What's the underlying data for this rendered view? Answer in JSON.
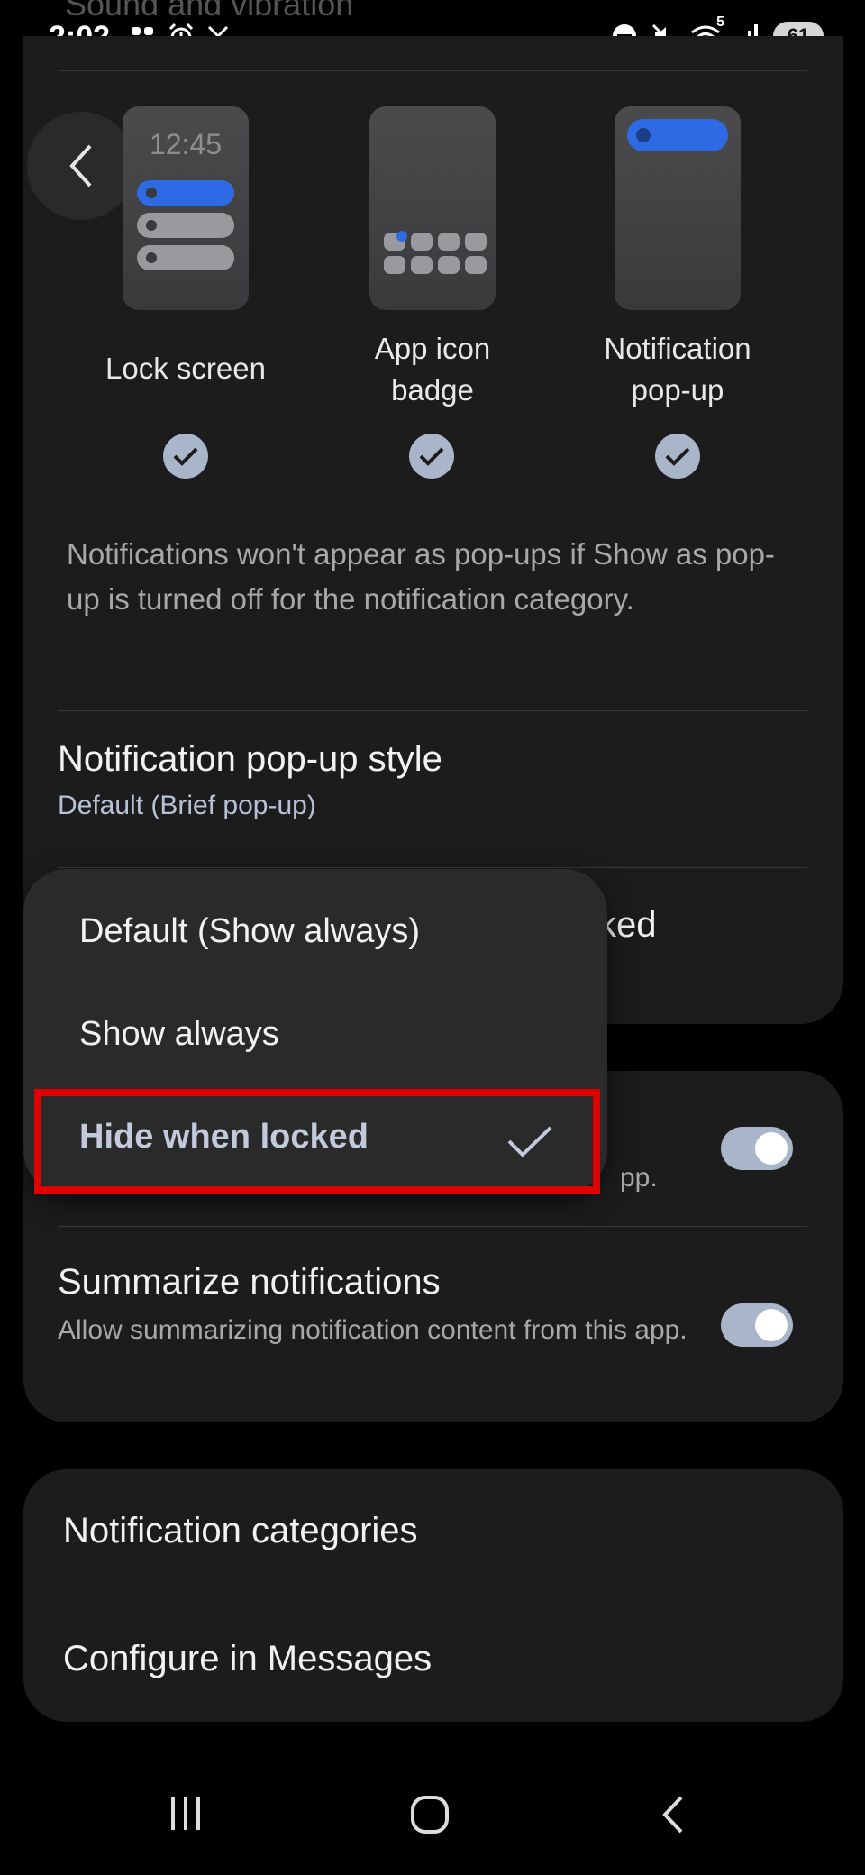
{
  "status_bar": {
    "time": "2:02",
    "left_icons": [
      "lightning-grid-icon",
      "alarm-icon",
      "missed-call-icon"
    ],
    "right_icons": [
      "do-not-disturb-icon",
      "mute-icon",
      "wifi-icon",
      "signal-icon"
    ],
    "wifi_label": "5",
    "battery": "61"
  },
  "header": {
    "title": "Sound and vibration",
    "back_icon": "chevron-left-icon"
  },
  "preview_options": [
    {
      "label": "Lock screen",
      "checked": true,
      "time": "12:45"
    },
    {
      "label": "App icon badge",
      "line1": "App icon",
      "line2": "badge",
      "checked": true
    },
    {
      "label": "Notification pop-up",
      "line1": "Notification",
      "line2": "pop-up",
      "checked": true
    }
  ],
  "description": "Notifications won't appear as pop-ups if Show as pop-up is turned off for the notification category.",
  "settings": {
    "popup_style": {
      "title": "Notification pop-up style",
      "value": "Default (Brief pop-up)"
    },
    "hidden_row_suffix": "ked",
    "hidden_toggle_desc_suffix": "pp.",
    "summarize": {
      "title": "Summarize notifications",
      "description": "Allow summarizing notification content from this app.",
      "enabled": true
    },
    "categories": "Notification categories",
    "configure": "Configure in Messages"
  },
  "dropdown": {
    "options": [
      "Default (Show always)",
      "Show always",
      "Hide when locked"
    ],
    "selected": "Hide when locked",
    "highlight_color": "#e10000"
  },
  "accent_color": "#2f6ae5",
  "nav_bar": {
    "icons": [
      "recents-icon",
      "home-icon",
      "back-icon"
    ]
  }
}
